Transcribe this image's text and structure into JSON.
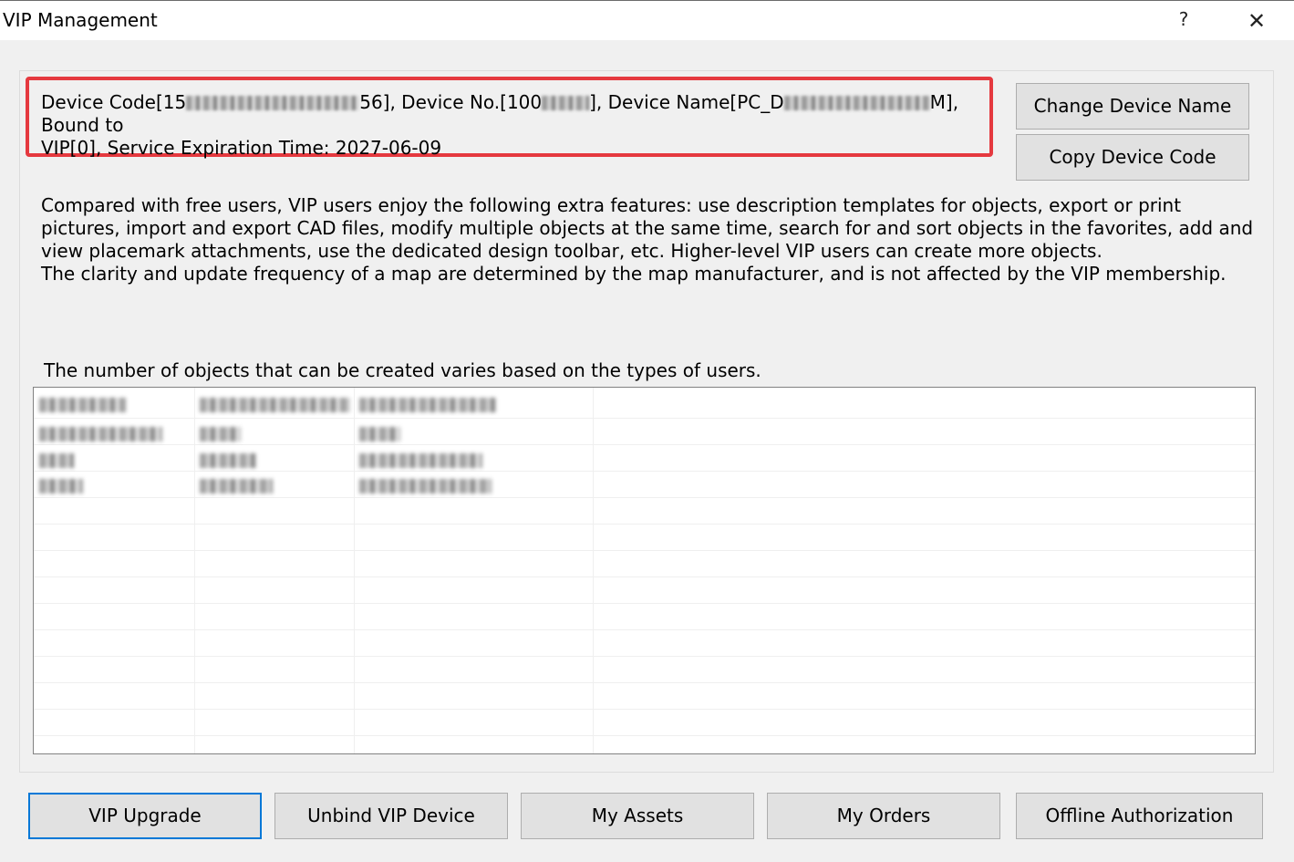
{
  "window": {
    "title": "VIP Management",
    "help_glyph": "?",
    "close_glyph": "✕"
  },
  "device_info": {
    "code_prefix": "Device Code[15",
    "code_suffix": "56], Device No.[100",
    "no_suffix": "], Device Name[PC_D",
    "name_suffix": "M], Bound to",
    "line2": "VIP[0], Service Expiration Time: 2027-06-09"
  },
  "buttons": {
    "change_device_name": "Change Device Name",
    "copy_device_code": "Copy Device Code",
    "vip_upgrade": "VIP Upgrade",
    "unbind_vip_device": "Unbind VIP Device",
    "my_assets": "My Assets",
    "my_orders": "My Orders",
    "offline_authorization": "Offline Authorization"
  },
  "description": {
    "paragraph1": "Compared with free users, VIP users enjoy the following extra features: use description templates for objects, export or print pictures, import and export CAD files, modify multiple objects at the same time, search for and sort objects in the favorites, add and view placemark attachments, use the dedicated design toolbar, etc. Higher-level VIP users can create more objects.",
    "paragraph2": "The clarity and update frequency of a map are determined by the map manufacturer, and is not affected by the VIP membership."
  },
  "table": {
    "caption": "The number of objects that can be created varies based on the types of users."
  },
  "colors": {
    "highlight_border": "#e5393f",
    "primary_button_border": "#0078d7",
    "button_face": "#e1e1e1",
    "window_bg": "#f0f0f0"
  }
}
